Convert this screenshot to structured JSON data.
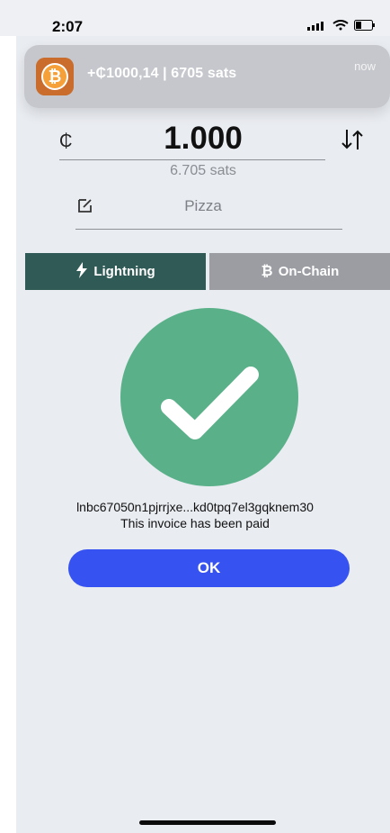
{
  "status_bar": {
    "time": "2:07"
  },
  "notification": {
    "text": "+₵1000,14 | 6705 sats",
    "time": "now",
    "icon": "bitcoin-icon"
  },
  "amount": {
    "currency_symbol": "₵",
    "value": "1.000",
    "sats": "6.705 sats",
    "swap_icon": "swap-arrows-icon"
  },
  "memo": {
    "text": "Pizza",
    "icon": "edit-note-icon"
  },
  "tabs": {
    "lightning": {
      "label": "Lightning",
      "icon": "lightning-icon"
    },
    "onchain": {
      "label": "On-Chain",
      "icon": "bitcoin-icon"
    }
  },
  "payment": {
    "invoice": "lnbc67050n1pjrrjxe...kd0tpq7el3gqknem30",
    "status": "This invoice has been paid"
  },
  "actions": {
    "ok_label": "OK"
  },
  "colors": {
    "tab_active": "#2f5a56",
    "tab_inactive": "#9b9da3",
    "success": "#5ab189",
    "primary_button": "#3652f1",
    "background": "#e9ecf1"
  }
}
